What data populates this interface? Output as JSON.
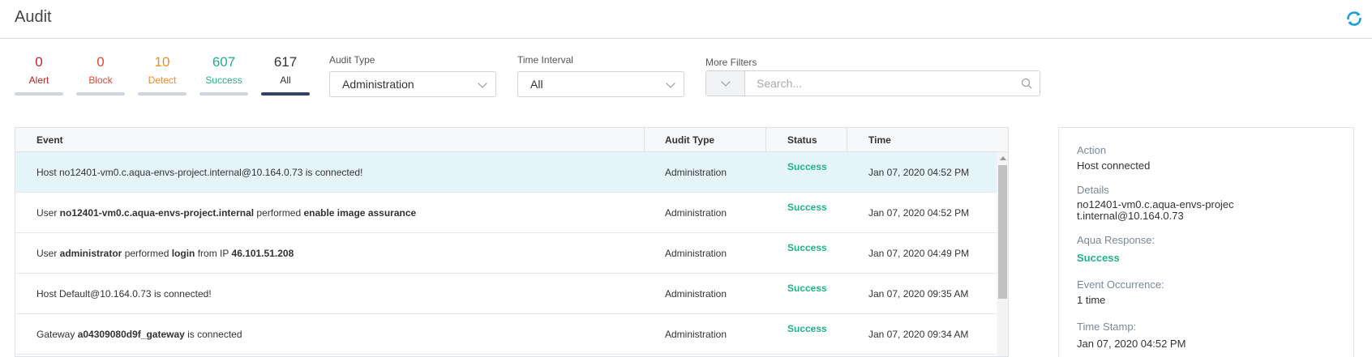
{
  "page": {
    "title": "Audit"
  },
  "counters": [
    {
      "num": "0",
      "label": "Alert",
      "color": "#b3262a"
    },
    {
      "num": "0",
      "label": "Block",
      "color": "#e0492e"
    },
    {
      "num": "10",
      "label": "Detect",
      "color": "#f08a24"
    },
    {
      "num": "607",
      "label": "Success",
      "color": "#21b08c"
    },
    {
      "num": "617",
      "label": "All",
      "color": "#333333"
    }
  ],
  "filters": {
    "audit_type": {
      "label": "Audit Type",
      "value": "Administration"
    },
    "time_interval": {
      "label": "Time Interval",
      "value": "All"
    },
    "more_filters": {
      "label": "More Filters",
      "placeholder": "Search..."
    }
  },
  "table": {
    "headers": {
      "event": "Event",
      "audit_type": "Audit Type",
      "status": "Status",
      "time": "Time"
    },
    "rows": [
      {
        "event": [
          {
            "t": "Host no12401-vm0.c.aqua-envs-project.internal@10.164.0.73 is connected!",
            "b": false
          }
        ],
        "audit_type": "Administration",
        "status": "Success",
        "time": "Jan 07, 2020 04:52 PM"
      },
      {
        "event": [
          {
            "t": "User ",
            "b": false
          },
          {
            "t": "no12401-vm0.c.aqua-envs-project.internal",
            "b": true
          },
          {
            "t": " performed ",
            "b": false
          },
          {
            "t": "enable image assurance",
            "b": true
          }
        ],
        "audit_type": "Administration",
        "status": "Success",
        "time": "Jan 07, 2020 04:52 PM"
      },
      {
        "event": [
          {
            "t": "User ",
            "b": false
          },
          {
            "t": "administrator",
            "b": true
          },
          {
            "t": " performed ",
            "b": false
          },
          {
            "t": "login",
            "b": true
          },
          {
            "t": " from IP ",
            "b": false
          },
          {
            "t": "46.101.51.208",
            "b": true
          }
        ],
        "audit_type": "Administration",
        "status": "Success",
        "time": "Jan 07, 2020 04:49 PM"
      },
      {
        "event": [
          {
            "t": "Host Default@10.164.0.73 is connected!",
            "b": false
          }
        ],
        "audit_type": "Administration",
        "status": "Success",
        "time": "Jan 07, 2020 09:35 AM"
      },
      {
        "event": [
          {
            "t": "Gateway ",
            "b": false
          },
          {
            "t": "a04309080d9f_gateway",
            "b": true
          },
          {
            "t": " is connected",
            "b": false
          }
        ],
        "audit_type": "Administration",
        "status": "Success",
        "time": "Jan 07, 2020 09:34 AM"
      }
    ]
  },
  "details": {
    "action_label": "Action",
    "action_value": "Host connected",
    "details_label": "Details",
    "details_value": "no12401-vm0.c.aqua-envs-project.internal@10.164.0.73",
    "response_label": "Aqua Response:",
    "response_value": "Success",
    "occurrence_label": "Event Occurrence:",
    "occurrence_value": "1 time",
    "timestamp_label": "Time Stamp:",
    "timestamp_value": "Jan 07, 2020 04:52 PM"
  },
  "colors": {
    "accent": "#1a9fd6",
    "success": "#21b08c",
    "selected_row": "#e5f4f8"
  },
  "icons": [
    "refresh-icon",
    "chevron-down-icon",
    "search-icon"
  ]
}
